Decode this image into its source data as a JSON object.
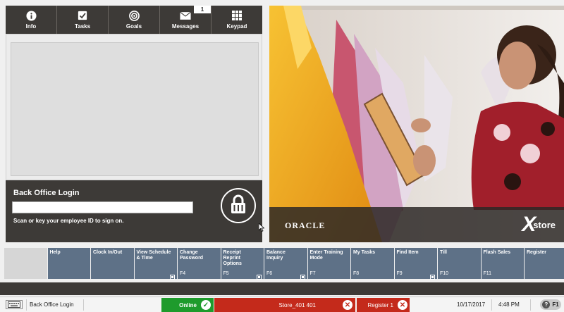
{
  "tabs": [
    {
      "label": "Info",
      "icon": "info-icon",
      "active": true
    },
    {
      "label": "Tasks",
      "icon": "checkbox-icon"
    },
    {
      "label": "Goals",
      "icon": "target-icon"
    },
    {
      "label": "Messages",
      "icon": "envelope-icon",
      "badge": "1"
    },
    {
      "label": "Keypad",
      "icon": "keypad-icon"
    }
  ],
  "login": {
    "title": "Back Office Login",
    "input_value": "",
    "hint": "Scan or key your employee ID to sign on."
  },
  "branding": {
    "oracle": "ORACLE",
    "xstore_x": "X",
    "xstore_word": "store"
  },
  "function_buttons": [
    {
      "label": "",
      "key": ""
    },
    {
      "label": "Help",
      "key": ""
    },
    {
      "label": "Clock In/Out",
      "key": ""
    },
    {
      "label": "View Schedule & Time",
      "key": "",
      "icon": true
    },
    {
      "label": "Change Password",
      "key": "F4"
    },
    {
      "label": "Receipt Reprint Options",
      "key": "F5",
      "icon": true
    },
    {
      "label": "Balance Inquiry",
      "key": "F6",
      "icon": true
    },
    {
      "label": "Enter Training Mode",
      "key": "F7"
    },
    {
      "label": "My Tasks",
      "key": "F8"
    },
    {
      "label": "Find Item",
      "key": "F9",
      "icon": true
    },
    {
      "label": "Till",
      "key": "F10"
    },
    {
      "label": "Flash Sales",
      "key": "F11"
    },
    {
      "label": "Register",
      "key": ""
    }
  ],
  "status": {
    "context": "Back Office Login",
    "online": "Online",
    "store": "Store_401 401",
    "register": "Register 1",
    "date": "10/17/2017",
    "time": "4:48 PM",
    "help_key": "F1"
  },
  "colors": {
    "dark": "#3d3a37",
    "button": "#5e7187",
    "online": "#1e9b2c",
    "alert": "#c42a1b"
  }
}
